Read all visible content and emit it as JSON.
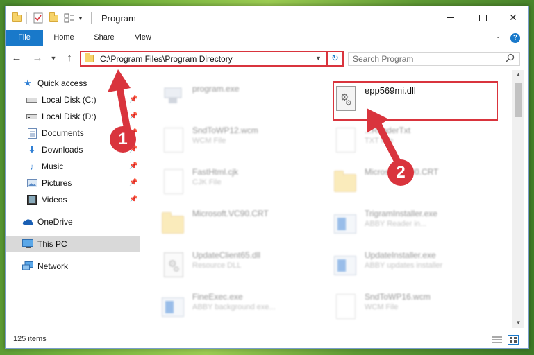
{
  "window": {
    "title": "Program",
    "buttons": {
      "minimize": "minimize",
      "maximize": "maximize",
      "close": "✕"
    }
  },
  "ribbon": {
    "tabs": [
      "File",
      "Home",
      "Share",
      "View"
    ],
    "help": "?"
  },
  "address": {
    "path": "C:\\Program Files\\Program Directory",
    "search_placeholder": "Search Program"
  },
  "sidebar": {
    "items": [
      {
        "label": "Quick access",
        "icon": "star-icon",
        "pinned": false
      },
      {
        "label": "Local Disk (C:)",
        "icon": "drive-icon",
        "pinned": true
      },
      {
        "label": "Local Disk (D:)",
        "icon": "drive-icon",
        "pinned": true
      },
      {
        "label": "Documents",
        "icon": "documents-icon",
        "pinned": true
      },
      {
        "label": "Downloads",
        "icon": "download-icon",
        "pinned": true
      },
      {
        "label": "Music",
        "icon": "music-icon",
        "pinned": true
      },
      {
        "label": "Pictures",
        "icon": "pictures-icon",
        "pinned": true
      },
      {
        "label": "Videos",
        "icon": "videos-icon",
        "pinned": true
      },
      {
        "label": "OneDrive",
        "icon": "cloud-icon",
        "pinned": false
      },
      {
        "label": "This PC",
        "icon": "pc-icon",
        "pinned": false,
        "selected": true
      },
      {
        "label": "Network",
        "icon": "network-icon",
        "pinned": false
      }
    ]
  },
  "files": [
    {
      "name": "program.exe",
      "sub": "",
      "icon": "program-icon",
      "blurred": true
    },
    {
      "name": "epp569mi.dll",
      "sub": "",
      "icon": "dll-gear-icon",
      "blurred": false,
      "highlighted": true
    },
    {
      "name": "SndToWP12.wcm",
      "sub": "WCM File",
      "icon": "document-icon",
      "blurred": true
    },
    {
      "name": "...ReaderTxt",
      "sub": "TXT File",
      "icon": "document-icon",
      "blurred": true
    },
    {
      "name": "FastHtml.cjk",
      "sub": "CJK File",
      "icon": "document-icon",
      "blurred": true
    },
    {
      "name": "Micros... VC90.CRT",
      "sub": "",
      "icon": "folder-icon",
      "blurred": true
    },
    {
      "name": "Microsoft.VC90.CRT",
      "sub": "",
      "icon": "folder-icon",
      "blurred": true
    },
    {
      "name": "TrigramInstaller.exe",
      "sub": "ABBY Reader in...",
      "icon": "installer-icon",
      "blurred": true
    },
    {
      "name": "UpdateClient65.dll",
      "sub": "Resource DLL",
      "icon": "dll-gear-icon",
      "blurred": true
    },
    {
      "name": "UpdateInstaller.exe",
      "sub": "ABBY updates installer",
      "icon": "installer-icon",
      "blurred": true
    },
    {
      "name": "FineExec.exe",
      "sub": "ABBY background exe...",
      "icon": "installer-icon",
      "blurred": true
    },
    {
      "name": "SndToWP16.wcm",
      "sub": "WCM File",
      "icon": "document-icon",
      "blurred": true
    }
  ],
  "status": {
    "item_count": "125 items"
  },
  "annotations": {
    "step1": "1",
    "step2": "2",
    "color": "#d9343d"
  }
}
